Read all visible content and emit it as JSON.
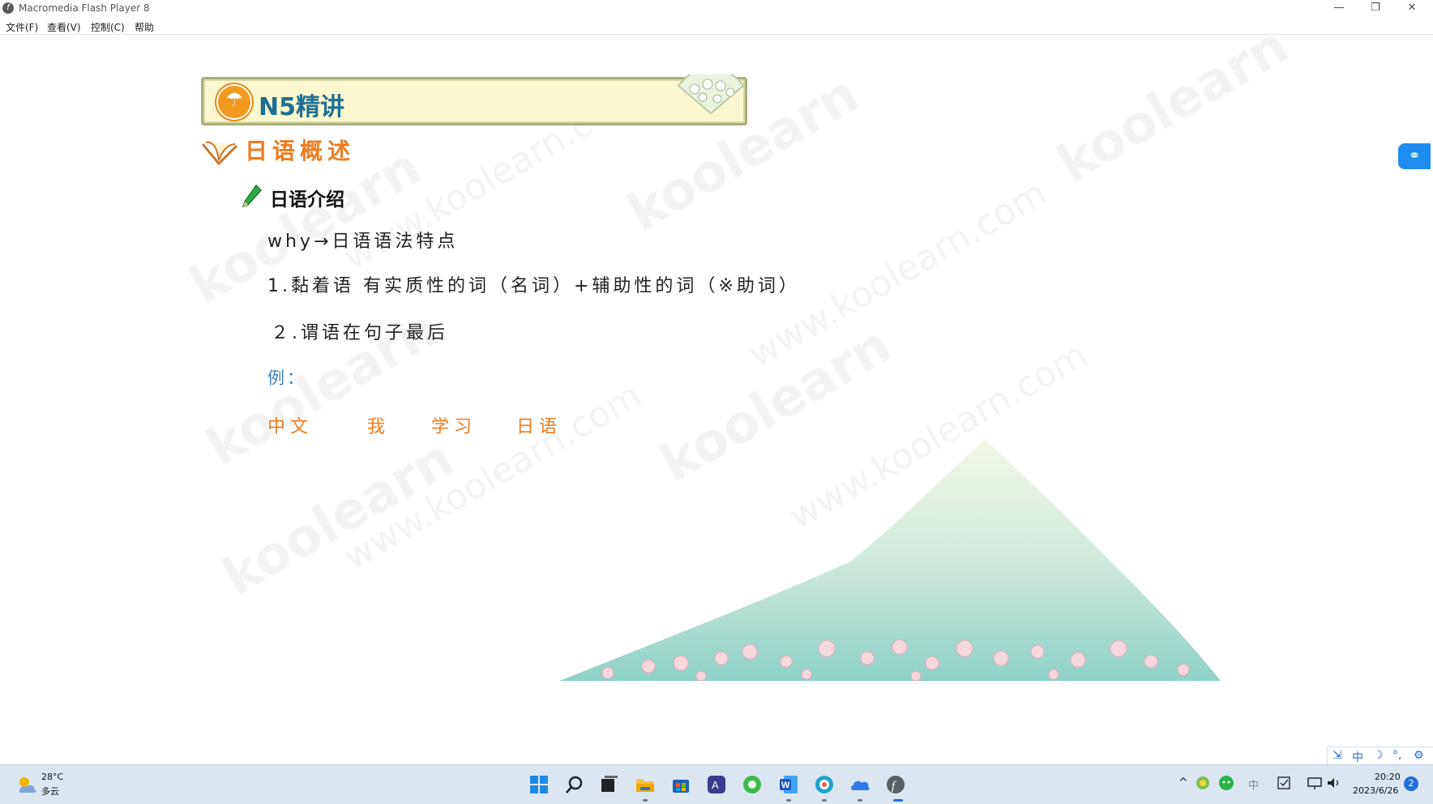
{
  "window": {
    "title": "Macromedia Flash Player 8",
    "controls": {
      "minimize": "—",
      "maximize": "❐",
      "close": "✕"
    }
  },
  "menu": [
    {
      "label": "文件(F)"
    },
    {
      "label": "查看(V)"
    },
    {
      "label": "控制(C)"
    },
    {
      "label": "帮助"
    }
  ],
  "slide": {
    "banner_title": "N5精讲",
    "section_title": "日语概述",
    "subsection_title": "日语介绍",
    "lines": [
      "why→日语语法特点",
      "1.黏着语   有实质性的词（名词）+辅助性的词（※助词）",
      "２.谓语在句子最后"
    ],
    "example_label": "例：",
    "example_words": [
      "中文",
      "我",
      "学习",
      "日语"
    ],
    "watermarks": [
      "koolearn",
      "www.koolearn.com"
    ],
    "side_tab_icon": "cloud-link-icon"
  },
  "ime_toolbar": {
    "items": [
      "⇲",
      "中",
      "☽",
      "°,",
      "⚙"
    ]
  },
  "taskbar": {
    "weather": {
      "temp": "28°C",
      "desc": "多云",
      "icon": "partly-cloudy-icon"
    },
    "apps": [
      "start-icon",
      "search-icon",
      "task-view-icon",
      "file-explorer-icon",
      "store-icon",
      "translate-icon",
      "browser-green-icon",
      "word-icon",
      "edge-icon",
      "cloud-drive-icon",
      "flash-player-icon"
    ],
    "tray": {
      "chevron": "^",
      "ime_label": "中"
    },
    "clock": {
      "time": "20:20",
      "date": "2023/6/26"
    },
    "notification_count": "2"
  },
  "colors": {
    "accent_orange": "#ef7b1f",
    "title_blue": "#1f6f94",
    "example_blue": "#3d7fbf",
    "taskbar": "#dbe6f1"
  }
}
